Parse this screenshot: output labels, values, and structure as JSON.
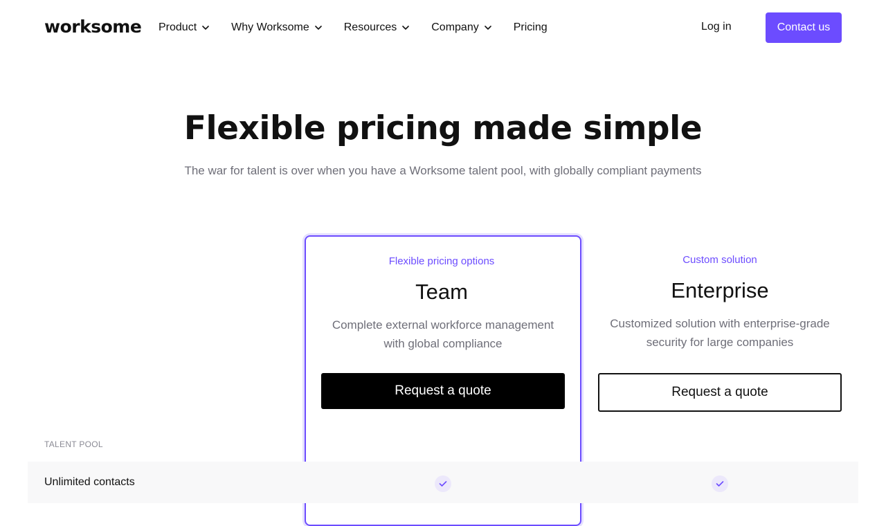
{
  "header": {
    "logo": "worksome",
    "nav": [
      {
        "label": "Product",
        "has_dropdown": true,
        "icon": "chevron-down-icon"
      },
      {
        "label": "Why Worksome",
        "has_dropdown": true,
        "icon": "chevron-down-icon"
      },
      {
        "label": "Resources",
        "has_dropdown": true,
        "icon": "chevron-down-icon"
      },
      {
        "label": "Company",
        "has_dropdown": true,
        "icon": "chevron-down-icon"
      },
      {
        "label": "Pricing",
        "has_dropdown": false
      }
    ],
    "login_label": "Log in",
    "contact_label": "Contact us"
  },
  "hero": {
    "title": "Flexible pricing made simple",
    "subtitle": "The war for talent is over when you have a Worksome talent pool, with globally compliant payments"
  },
  "plans": [
    {
      "eyebrow": "Flexible pricing options",
      "name": "Team",
      "description": "Complete external workforce management with global compliance",
      "cta": "Request a quote"
    },
    {
      "eyebrow": "Custom solution",
      "name": "Enterprise",
      "description": "Customized solution with enterprise-grade security for large companies",
      "cta": "Request a quote"
    }
  ],
  "features": {
    "section_label": "TALENT POOL",
    "rows": [
      {
        "name": "Unlimited contacts",
        "team": true,
        "enterprise": true
      }
    ]
  },
  "colors": {
    "accent": "#6c4cff",
    "text": "#111111",
    "muted": "#6e6e78",
    "check_bg": "#ece8fb",
    "row_bg": "#f8f8f9"
  }
}
